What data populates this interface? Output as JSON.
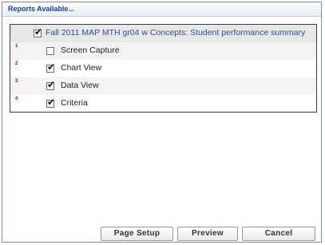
{
  "dialog": {
    "title": "Reports Available..."
  },
  "report": {
    "name": "Fall 2011 MAP MTH gr04 w Concepts: Student performance summary",
    "checked": true
  },
  "items": [
    {
      "number": "1",
      "label": "Screen Capture",
      "checked": false
    },
    {
      "number": "2",
      "label": "Chart View",
      "checked": true
    },
    {
      "number": "3",
      "label": "Data View",
      "checked": true
    },
    {
      "number": "4",
      "label": "Criteria",
      "checked": true
    }
  ],
  "buttons": {
    "page_setup": "Page Setup",
    "preview": "Preview",
    "cancel": "Cancel"
  },
  "check_glyph": "✔"
}
